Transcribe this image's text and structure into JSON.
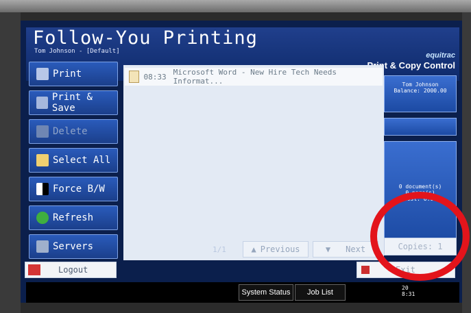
{
  "header": {
    "title": "Follow-You Printing",
    "user_line": "Tom Johnson - [Default]",
    "brand": "equitrac",
    "brand_subtitle": "Print & Copy Control"
  },
  "sidebar": {
    "items": [
      {
        "label": "Print",
        "icon": "printer-icon",
        "enabled": true
      },
      {
        "label": "Print & Save",
        "icon": "print-save-icon",
        "enabled": true
      },
      {
        "label": "Delete",
        "icon": "delete-icon",
        "enabled": false
      },
      {
        "label": "Select All",
        "icon": "select-all-icon",
        "enabled": true
      },
      {
        "label": "Force B/W",
        "icon": "bw-icon",
        "enabled": true
      },
      {
        "label": "Refresh",
        "icon": "refresh-icon",
        "enabled": true
      },
      {
        "label": "Servers",
        "icon": "server-icon",
        "enabled": true
      }
    ],
    "logout_label": "Logout"
  },
  "jobs": [
    {
      "time": "08:33",
      "name": "Microsoft Word - New Hire Tech Needs Informat..."
    }
  ],
  "pagination": {
    "page": "1/1",
    "previous_label": "Previous",
    "next_label": "Next"
  },
  "account": {
    "name": "Tom Johnson",
    "balance": "Balance: 2000.00"
  },
  "summary": {
    "documents": "0 document(s)",
    "pages": "0 page(s)",
    "cost": "Cost: 0.00"
  },
  "copies_label": "Copies: 1",
  "exit_label": "Exit",
  "taskbar": {
    "system_status": "System Status",
    "job_list": "Job List",
    "clock_line1": "20",
    "clock_line2": "8:31"
  }
}
